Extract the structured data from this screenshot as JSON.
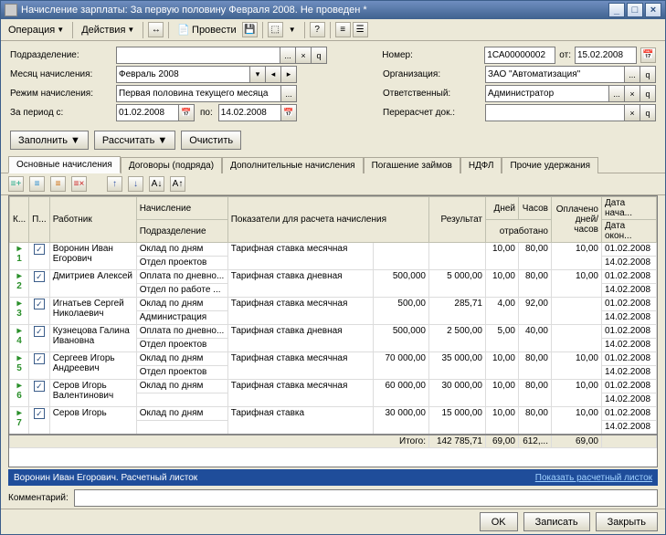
{
  "title": "Начисление зарплаты: За первую половину Февраля 2008. Не проведен *",
  "menu": {
    "op": "Операция",
    "act": "Действия",
    "prov": "Провести"
  },
  "form": {
    "subdiv_label": "Подразделение:",
    "month_label": "Месяц начисления:",
    "month_val": "Февраль 2008",
    "mode_label": "Режим начисления:",
    "mode_val": "Первая половина текущего месяца",
    "period_label": "За период с:",
    "period_from": "01.02.2008",
    "period_to_lbl": "по:",
    "period_to": "14.02.2008",
    "num_label": "Номер:",
    "num_val": "1СА00000002",
    "ot": "от:",
    "date_val": "15.02.2008",
    "org_label": "Организация:",
    "org_val": "ЗАО \"Автоматизация\"",
    "resp_label": "Ответственный:",
    "resp_val": "Администратор",
    "recalc_label": "Перерасчет док.:"
  },
  "buttons": {
    "fill": "Заполнить",
    "calc": "Рассчитать",
    "clear": "Очистить"
  },
  "tabs": [
    "Основные начисления",
    "Договоры (подряда)",
    "Дополнительные начисления",
    "Погашение займов",
    "НДФЛ",
    "Прочие удержания"
  ],
  "grid": {
    "headers": {
      "k": "К...",
      "p": "П...",
      "emp": "Работник",
      "acc": "Начисление",
      "sub": "Подразделение",
      "ind": "Показатели для расчета\nначисления",
      "res": "Результат",
      "days": "Дней",
      "hours": "Часов",
      "worked": "отработано",
      "paid": "Оплачено\nдней/часов",
      "dstart": "Дата нача...",
      "dend": "Дата окон..."
    },
    "rows": [
      {
        "n": 1,
        "emp": "Воронин Иван Егорович",
        "acc": "Оклад по дням",
        "sub": "Отдел проектов",
        "ind": "Тарифная ставка месячная",
        "indval": "",
        "res": "",
        "days": "10,00",
        "hours": "80,00",
        "paid": "10,00",
        "d1": "01.02.2008",
        "d2": "14.02.2008"
      },
      {
        "n": 2,
        "emp": "Дмитриев Алексей",
        "acc": "Оплата по дневно...",
        "sub": "Отдел по работе ...",
        "ind": "Тарифная ставка дневная",
        "indval": "500,000",
        "res": "5 000,00",
        "days": "10,00",
        "hours": "80,00",
        "paid": "10,00",
        "d1": "01.02.2008",
        "d2": "14.02.2008"
      },
      {
        "n": 3,
        "emp": "Игнатьев Сергей Николаевич",
        "acc": "Оклад по дням",
        "sub": "Администрация",
        "ind": "Тарифная ставка месячная",
        "indval": "500,00",
        "res": "285,71",
        "days": "4,00",
        "hours": "92,00",
        "paid": "",
        "d1": "01.02.2008",
        "d2": "14.02.2008"
      },
      {
        "n": 4,
        "emp": "Кузнецова Галина Ивановна",
        "acc": "Оплата по дневно...",
        "sub": "Отдел проектов",
        "ind": "Тарифная ставка дневная",
        "indval": "500,000",
        "res": "2 500,00",
        "days": "5,00",
        "hours": "40,00",
        "paid": "",
        "d1": "01.02.2008",
        "d2": "14.02.2008"
      },
      {
        "n": 5,
        "emp": "Сергеев Игорь Андреевич",
        "acc": "Оклад по дням",
        "sub": "Отдел проектов",
        "ind": "Тарифная ставка месячная",
        "indval": "70 000,00",
        "res": "35 000,00",
        "days": "10,00",
        "hours": "80,00",
        "paid": "10,00",
        "d1": "01.02.2008",
        "d2": "14.02.2008"
      },
      {
        "n": 6,
        "emp": "Серов Игорь Валентинович",
        "acc": "Оклад по дням",
        "sub": "",
        "ind": "Тарифная ставка месячная",
        "indval": "60 000,00",
        "res": "30 000,00",
        "days": "10,00",
        "hours": "80,00",
        "paid": "10,00",
        "d1": "01.02.2008",
        "d2": "14.02.2008"
      },
      {
        "n": 7,
        "emp": "Серов Игорь",
        "acc": "Оклад по дням",
        "sub": "",
        "ind": "Тарифная ставка",
        "indval": "30 000,00",
        "res": "15 000,00",
        "days": "10,00",
        "hours": "80,00",
        "paid": "10,00",
        "d1": "01.02.2008",
        "d2": "14.02.2008"
      }
    ],
    "totals": {
      "label": "Итого:",
      "res": "142 785,71",
      "days": "69,00",
      "hours": "612,...",
      "paid": "69,00"
    }
  },
  "info": {
    "name": "Воронин Иван Егорович. Расчетный листок",
    "link": "Показать расчетный листок"
  },
  "comment_label": "Комментарий:",
  "footer": {
    "ok": "OK",
    "save": "Записать",
    "close": "Закрыть"
  }
}
